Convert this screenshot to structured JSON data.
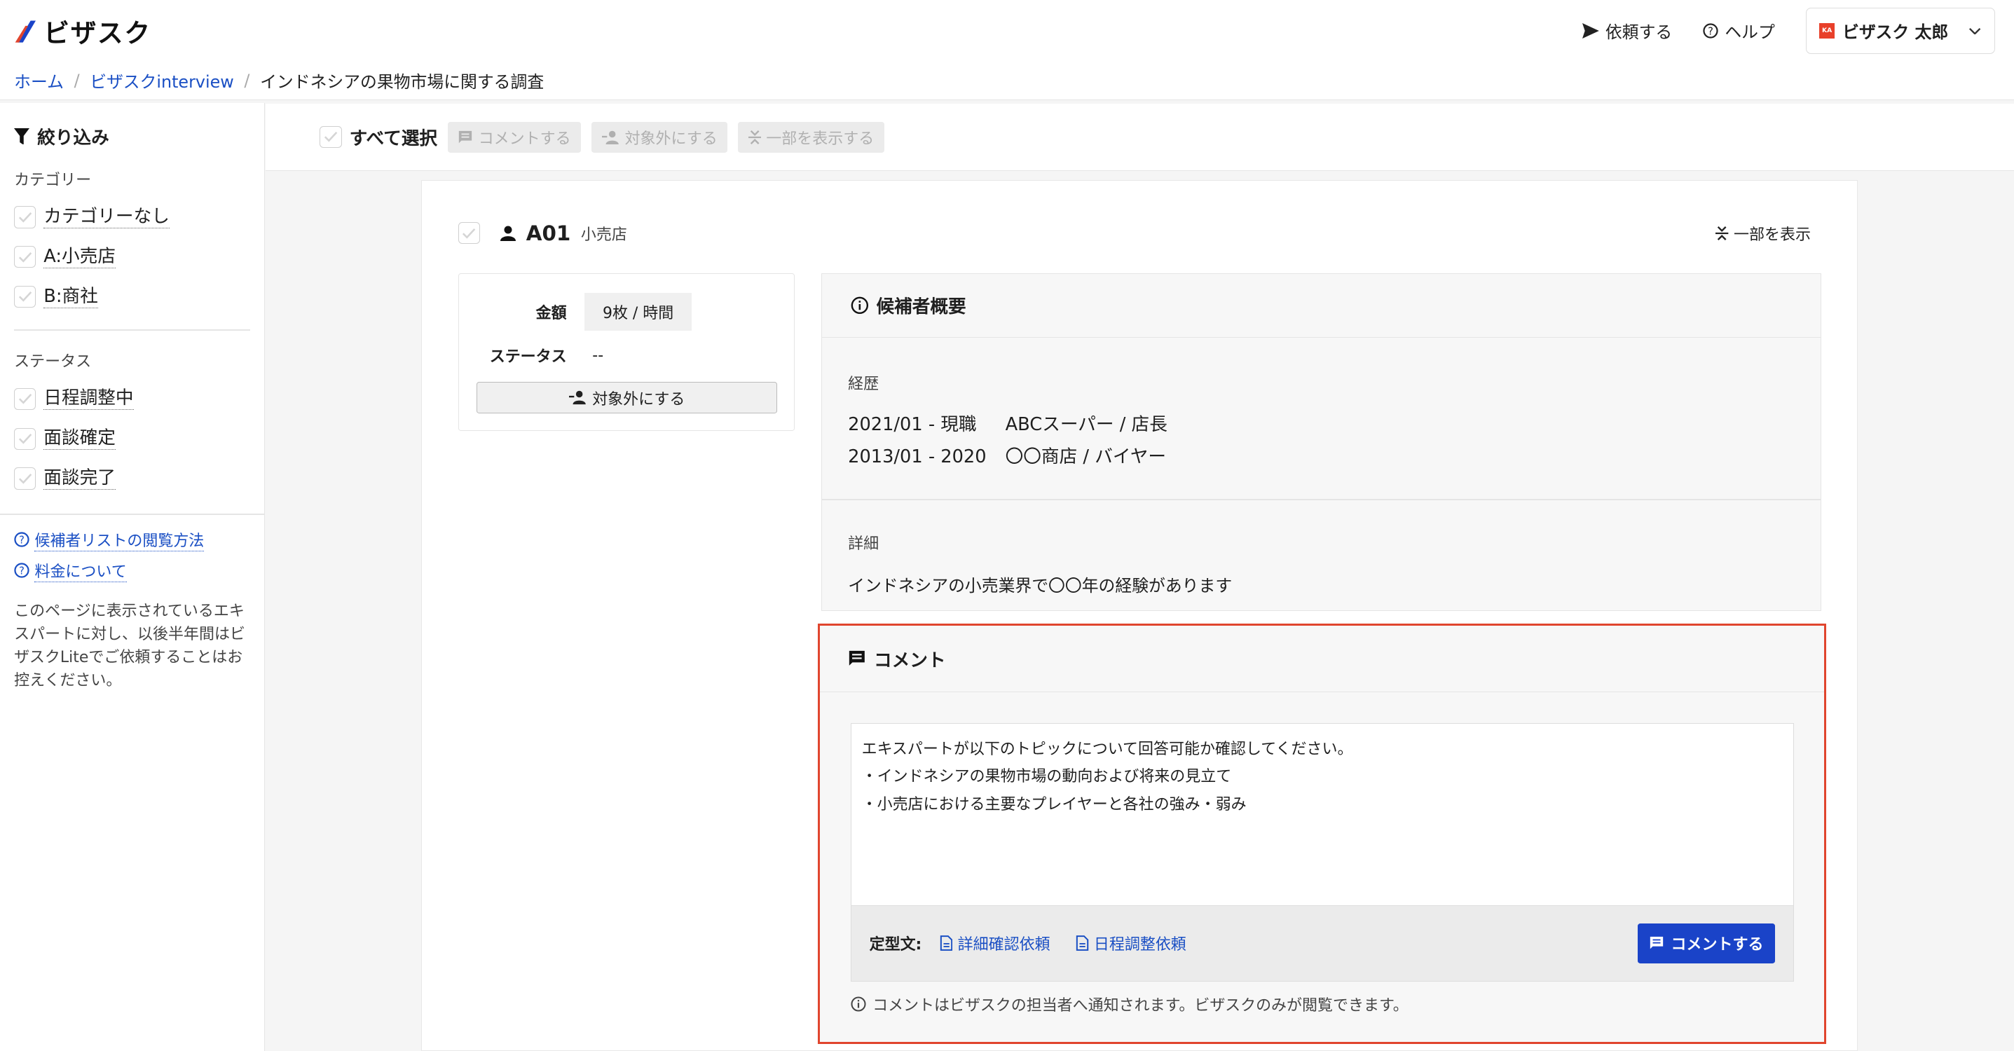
{
  "header": {
    "logo_text": "ビザスク",
    "request_label": "依頼する",
    "help_label": "ヘルプ",
    "user_name": "ビザスク 太郎",
    "avatar_initials": "KA"
  },
  "breadcrumb": {
    "home": "ホーム",
    "parent": "ビザスクinterview",
    "current": "インドネシアの果物市場に関する調査"
  },
  "sidebar": {
    "filter_title": "絞り込み",
    "category_label": "カテゴリー",
    "categories": [
      "カテゴリーなし",
      "A:小売店",
      "B:商社"
    ],
    "status_label": "ステータス",
    "statuses": [
      "日程調整中",
      "面談確定",
      "面談完了"
    ],
    "help_links": [
      "候補者リストの閲覧方法",
      "料金について"
    ],
    "note": "このページに表示されているエキスパートに対し、以後半年間はビザスクLiteでご依頼することはお控えください。"
  },
  "toolbar": {
    "select_all": "すべて選択",
    "comment": "コメントする",
    "exclude": "対象外にする",
    "show_part": "一部を表示する"
  },
  "candidate": {
    "id": "A01",
    "tag": "小売店",
    "show_part": "一部を表示",
    "fee_label": "金額",
    "fee_value": "9枚 / 時間",
    "status_label": "ステータス",
    "status_value": "--",
    "exclude_button": "対象外にする"
  },
  "summary": {
    "title": "候補者概要",
    "career_label": "経歴",
    "career": [
      {
        "period": "2021/01 - 現職",
        "org": "ABCスーパー / 店長"
      },
      {
        "period": "2013/01 - 2020",
        "org": "〇〇商店 / バイヤー"
      }
    ],
    "detail_label": "詳細",
    "detail": "インドネシアの小売業界で〇〇年の経験があります"
  },
  "comment": {
    "title": "コメント",
    "text": "エキスパートが以下のトピックについて回答可能か確認してください。\n・インドネシアの果物市場の動向および将来の見立て\n・小売店における主要なプレイヤーと各社の強み・弱み",
    "template_label": "定型文:",
    "template_detail": "詳細確認依頼",
    "template_schedule": "日程調整依頼",
    "submit": "コメントする",
    "note": "コメントはビザスクの担当者へ通知されます。ビザスクのみが閲覧できます。"
  },
  "colors": {
    "link": "#1a4fc4",
    "primary_button": "#1a43c8",
    "highlight_border": "#e0452e"
  }
}
